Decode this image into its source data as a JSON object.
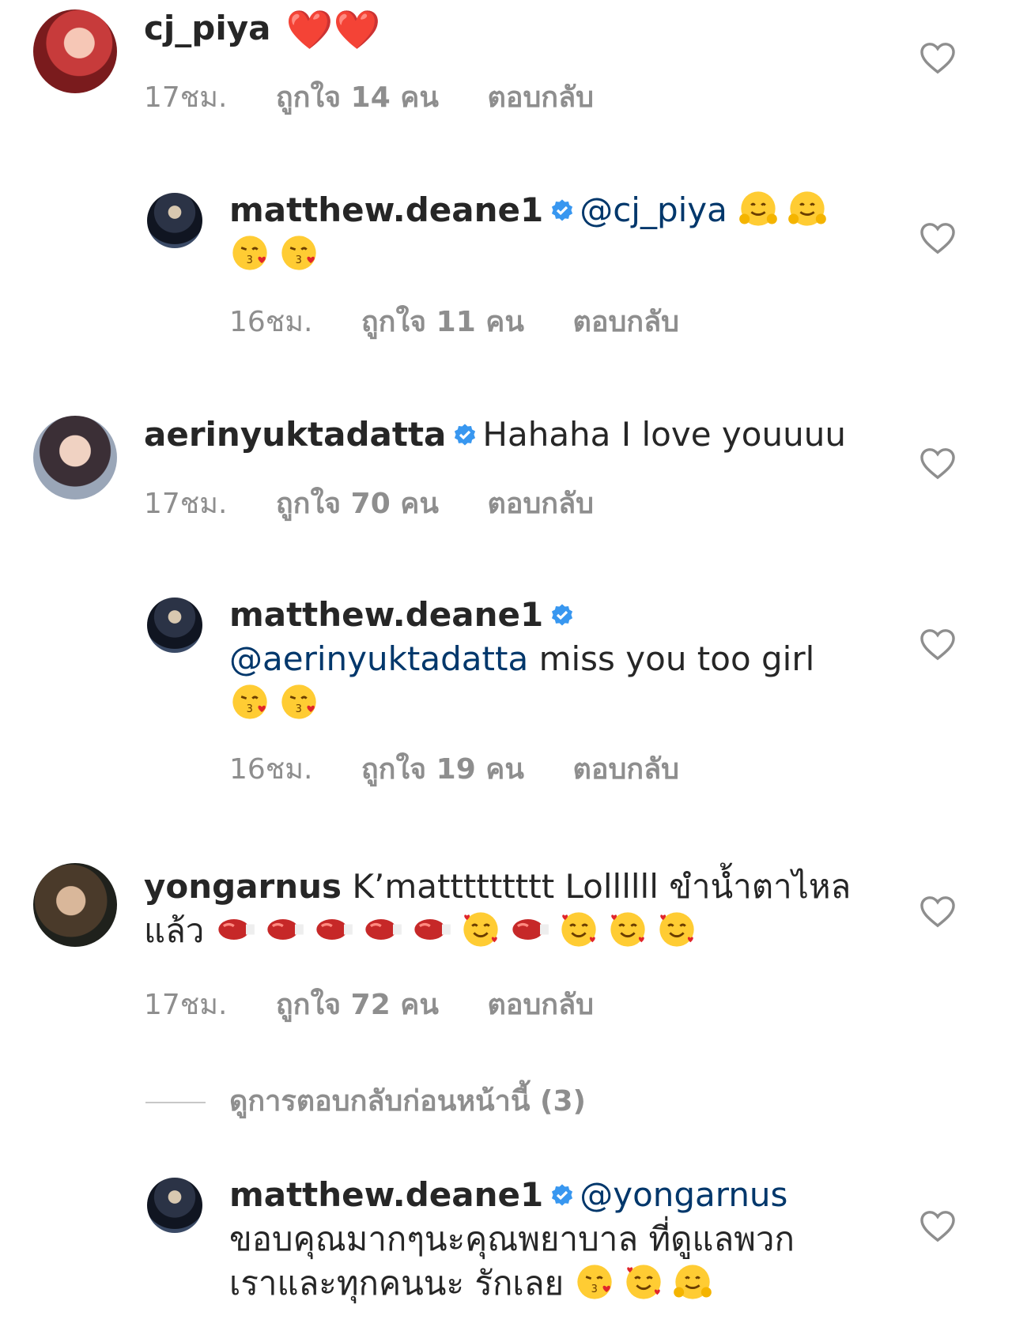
{
  "comments": [
    {
      "username": "cj_piya",
      "text": "❤️❤️",
      "time": "17ชม.",
      "likes": "ถูกใจ 14 คน",
      "reply": "ตอบกลับ"
    },
    {
      "username": "matthew.deane1",
      "mention": "@cj_piya",
      "time": "16ชม.",
      "likes": "ถูกใจ 11 คน",
      "reply": "ตอบกลับ"
    },
    {
      "username": "aerinyuktadatta",
      "text": "Hahaha I love youuuu",
      "time": "17ชม.",
      "likes": "ถูกใจ 70 คน",
      "reply": "ตอบกลับ"
    },
    {
      "username": "matthew.deane1",
      "mention": "@aerinyuktadatta",
      "text": " miss you too girl",
      "time": "16ชม.",
      "likes": "ถูกใจ 19 คน",
      "reply": "ตอบกลับ"
    },
    {
      "username": "yongarnus",
      "text": "K’mattttttttt Lollllll ขำน้ำตาไหล",
      "text2": "แล้ว",
      "time": "17ชม.",
      "likes": "ถูกใจ 72 คน",
      "reply": "ตอบกลับ"
    },
    {
      "username": "matthew.deane1",
      "mention": "@yongarnus",
      "text": "ขอบคุณมากๆนะคุณพยาบาล ที่ดูแลพวก",
      "text2": "เราและทุกคนนะ รักเลย"
    }
  ],
  "view_previous_replies": "ดูการตอบกลับก่อนหน้านี้ (3)",
  "icons": {
    "verified": "verified-badge-icon",
    "like": "heart-outline-icon"
  },
  "colors": {
    "verified": "#3897f0",
    "mention": "#00376b",
    "meta": "#8e8e8e"
  }
}
